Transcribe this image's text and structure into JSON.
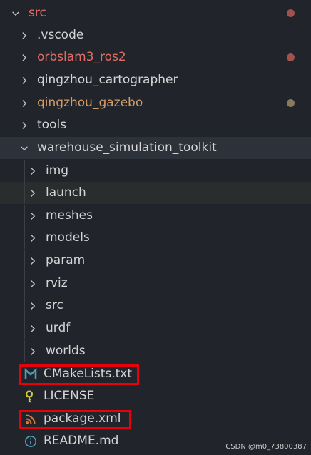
{
  "explorer": {
    "root": {
      "label": "src",
      "status": "modified",
      "dot_color": "#a0524c"
    },
    "top_items": [
      {
        "label": ".vscode",
        "status": "none"
      },
      {
        "label": "orbslam3_ros2",
        "status": "modified",
        "dot_color": "#a0524c"
      },
      {
        "label": "qingzhou_cartographer",
        "status": "none"
      },
      {
        "label": "qingzhou_gazebo",
        "status": "untracked",
        "dot_color": "#8a7a5c"
      },
      {
        "label": "tools",
        "status": "none"
      }
    ],
    "expanded_folder": {
      "label": "warehouse_simulation_toolkit"
    },
    "sub_folders": [
      {
        "label": "img"
      },
      {
        "label": "launch"
      },
      {
        "label": "meshes"
      },
      {
        "label": "models"
      },
      {
        "label": "param"
      },
      {
        "label": "rviz"
      },
      {
        "label": "src"
      },
      {
        "label": "urdf"
      },
      {
        "label": "worlds"
      }
    ],
    "files": [
      {
        "label": "CMakeLists.txt",
        "icon": "cmake-icon",
        "icon_color": "#519aba",
        "highlighted": true
      },
      {
        "label": "LICENSE",
        "icon": "key-icon",
        "icon_color": "#cbcb41",
        "highlighted": false
      },
      {
        "label": "package.xml",
        "icon": "rss-icon",
        "icon_color": "#e37933",
        "highlighted": true
      },
      {
        "label": "README.md",
        "icon": "info-icon",
        "icon_color": "#519aba",
        "highlighted": false
      }
    ]
  },
  "colors": {
    "background": "#21252b",
    "text": "#d4d4d4",
    "modified_text": "#e06c63",
    "annotation_box": "#e8000a"
  },
  "watermark": "CSDN @m0_73800387"
}
